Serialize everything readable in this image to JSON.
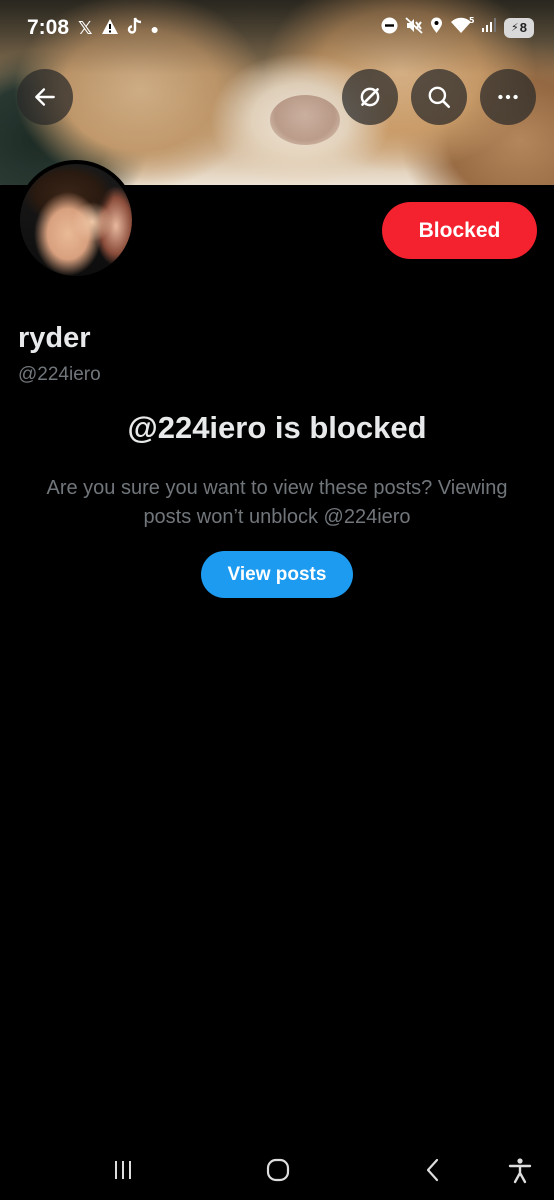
{
  "status_bar": {
    "time": "7:08",
    "left_icons": [
      "x-logo-icon",
      "warning-icon",
      "tiktok-icon",
      "dot-icon"
    ],
    "right_icons": [
      "dnd-icon",
      "mute-icon",
      "location-icon",
      "wifi-icon",
      "signal-icon"
    ],
    "battery_level": "8"
  },
  "header": {
    "back_icon": "arrow-left-icon",
    "actions": [
      "grok-icon",
      "search-icon",
      "more-icon"
    ]
  },
  "profile": {
    "blocked_label": "Blocked",
    "display_name": "ryder",
    "handle": "@224iero"
  },
  "blocked_notice": {
    "title": "@224iero is blocked",
    "description": "Are you sure you want to view these posts? Viewing posts won’t unblock @224iero",
    "view_button": "View posts"
  },
  "navigation": {
    "items": [
      "recent-apps-icon",
      "home-icon",
      "back-icon",
      "accessibility-icon"
    ]
  },
  "colors": {
    "blocked": "#f4212e",
    "primary": "#1d9bf0",
    "text_primary": "#e7e9ea",
    "text_secondary": "#71767b",
    "background": "#000000"
  }
}
